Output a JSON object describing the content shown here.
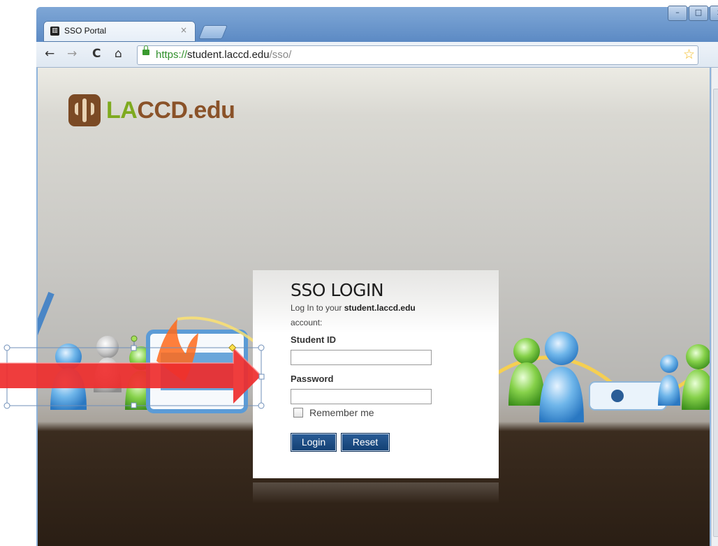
{
  "browser": {
    "tab": {
      "title": "SSO Portal",
      "close": "×"
    },
    "window_controls": [
      "–",
      "□",
      "x"
    ],
    "nav": {
      "back": "←",
      "forward": "→",
      "reload": "C",
      "home": "⌂"
    },
    "url": {
      "scheme": "https://",
      "host": "student.laccd.edu",
      "path": "/sso/"
    },
    "bookmark_star": "☆",
    "menu_wrench": "🔧"
  },
  "logo": {
    "la": "LA",
    "rest": "CCD.edu"
  },
  "login": {
    "title": "SSO LOGIN",
    "subtitle_prefix": "Log In to your ",
    "subtitle_domain": "student.laccd.edu",
    "subtitle_suffix": "account:",
    "student_id_label": "Student ID",
    "student_id_value": "",
    "password_label": "Password",
    "password_value": "",
    "remember_label": "Remember me",
    "login_button": "Login",
    "reset_button": "Reset"
  },
  "colors": {
    "chrome_blue": "#6d97cc",
    "url_green": "#2f8f2a",
    "logo_green": "#7eaa1f",
    "logo_brown": "#8a5228",
    "button_blue": "#1b4a82",
    "annotation_red": "#ee2c2c"
  }
}
